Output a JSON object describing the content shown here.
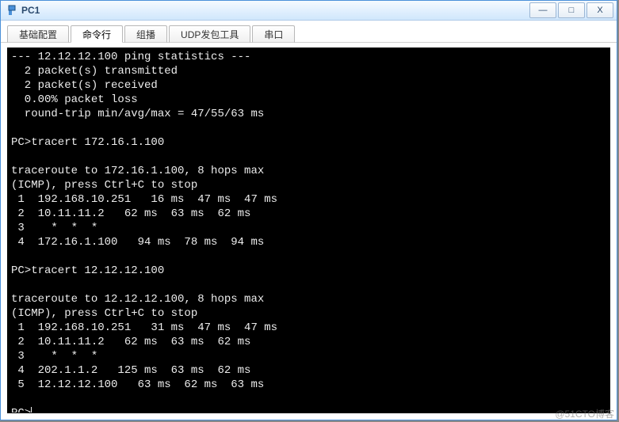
{
  "window": {
    "title": "PC1",
    "buttons": {
      "min": "—",
      "max": "□",
      "close": "X"
    }
  },
  "tabs": [
    {
      "label": "基础配置",
      "active": false
    },
    {
      "label": "命令行",
      "active": true
    },
    {
      "label": "组播",
      "active": false
    },
    {
      "label": "UDP发包工具",
      "active": false
    },
    {
      "label": "串口",
      "active": false
    }
  ],
  "terminal": {
    "prompt": "PC>",
    "lines": [
      "--- 12.12.12.100 ping statistics ---",
      "  2 packet(s) transmitted",
      "  2 packet(s) received",
      "  0.00% packet loss",
      "  round-trip min/avg/max = 47/55/63 ms",
      "",
      "PC>tracert 172.16.1.100",
      "",
      "traceroute to 172.16.1.100, 8 hops max",
      "(ICMP), press Ctrl+C to stop",
      " 1  192.168.10.251   16 ms  47 ms  47 ms",
      " 2  10.11.11.2   62 ms  63 ms  62 ms",
      " 3    *  *  *",
      " 4  172.16.1.100   94 ms  78 ms  94 ms",
      "",
      "PC>tracert 12.12.12.100",
      "",
      "traceroute to 12.12.12.100, 8 hops max",
      "(ICMP), press Ctrl+C to stop",
      " 1  192.168.10.251   31 ms  47 ms  47 ms",
      " 2  10.11.11.2   62 ms  63 ms  62 ms",
      " 3    *  *  *",
      " 4  202.1.1.2   125 ms  63 ms  62 ms",
      " 5  12.12.12.100   63 ms  62 ms  63 ms",
      ""
    ]
  },
  "watermark": "@51CTO博客"
}
